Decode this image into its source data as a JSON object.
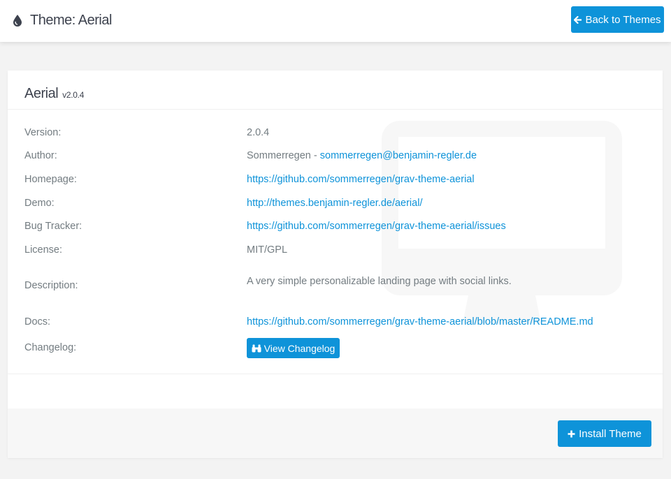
{
  "header": {
    "title": "Theme: Aerial",
    "back_button_label": "Back to Themes",
    "icon": "grav-drop-icon"
  },
  "theme": {
    "name": "Aerial",
    "version_tag": "v2.0.4"
  },
  "details": {
    "version_label": "Version:",
    "version_value": "2.0.4",
    "author_label": "Author:",
    "author_name": "Sommerregen",
    "author_sep": " - ",
    "author_email": "sommerregen@benjamin-regler.de",
    "homepage_label": "Homepage:",
    "homepage_value": "https://github.com/sommerregen/grav-theme-aerial",
    "demo_label": "Demo:",
    "demo_value": "http://themes.benjamin-regler.de/aerial/",
    "bugtracker_label": "Bug Tracker:",
    "bugtracker_value": "https://github.com/sommerregen/grav-theme-aerial/issues",
    "license_label": "License:",
    "license_value": "MIT/GPL",
    "description_label": "Description:",
    "description_value": "A very simple personalizable landing page with social links.",
    "docs_label": "Docs:",
    "docs_value": "https://github.com/sommerregen/grav-theme-aerial/blob/master/README.md",
    "changelog_label": "Changelog:",
    "changelog_button_label": "View Changelog"
  },
  "footer": {
    "install_button_label": "Install Theme"
  },
  "colors": {
    "accent": "#0e93d9",
    "text": "#737c81",
    "heading": "#3d424e",
    "background": "#f3f3f3"
  }
}
